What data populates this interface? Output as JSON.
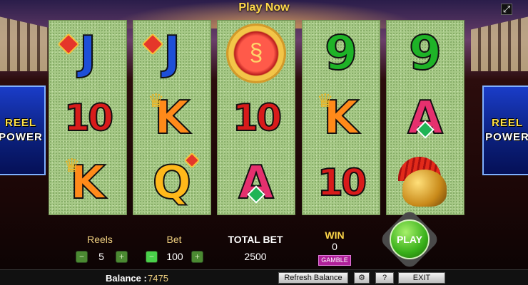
{
  "title": "Play Now",
  "side_logo": {
    "line1": "REEL",
    "line2": "POWER"
  },
  "reels": [
    [
      "J",
      "10",
      "K"
    ],
    [
      "J",
      "K",
      "Q"
    ],
    [
      "coin",
      "10",
      "A"
    ],
    [
      "9",
      "K",
      "10"
    ],
    [
      "9",
      "A",
      "helmet"
    ]
  ],
  "controls": {
    "reels": {
      "label": "Reels",
      "value": "5",
      "minus": "−",
      "plus": "+"
    },
    "bet": {
      "label": "Bet",
      "value": "100",
      "minus": "−",
      "plus": "+"
    },
    "total_bet": {
      "label": "TOTAL BET",
      "value": "2500"
    },
    "win": {
      "label": "WIN",
      "value": "0"
    },
    "gamble": "GAMBLE",
    "play": "PLAY"
  },
  "status": {
    "balance_label": "Balance :",
    "balance_value": "7475",
    "refresh": "Refresh Balance",
    "settings_icon": "gear-icon",
    "help": "?",
    "exit": "EXIT"
  },
  "colors": {
    "accent": "#ffd84a",
    "win": "#f0d080",
    "reel_bg": "#a6c886"
  }
}
